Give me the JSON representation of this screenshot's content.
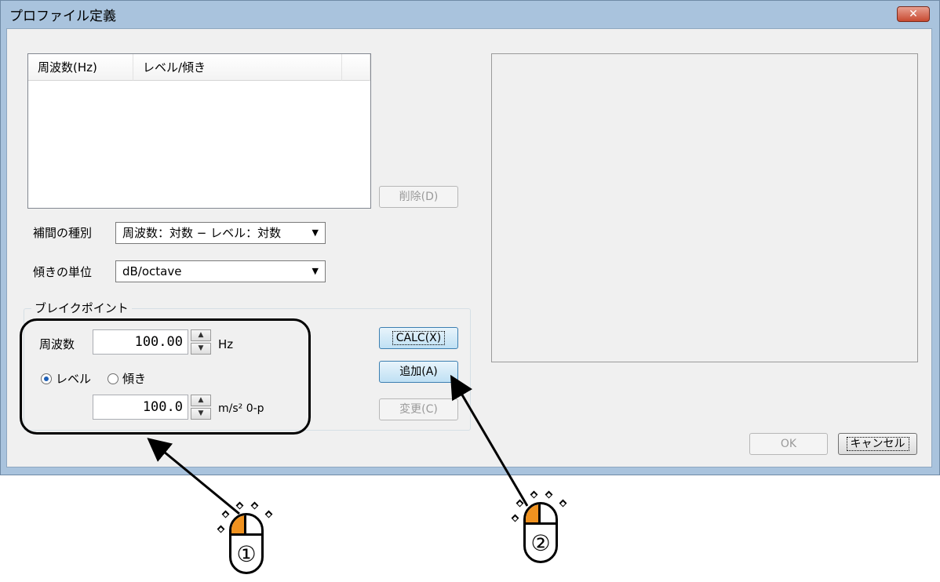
{
  "dialog": {
    "title": "プロファイル定義",
    "close_label": "✕"
  },
  "list": {
    "columns": [
      "周波数(Hz)",
      "レベル/傾き"
    ],
    "rows": []
  },
  "buttons": {
    "delete": "削除(D)",
    "calc": "CALC(X)",
    "add": "追加(A)",
    "change": "変更(C)",
    "ok": "OK",
    "cancel": "キャンセル"
  },
  "interpolation": {
    "label": "補間の種別",
    "value": "周波数：対数 − レベル：対数"
  },
  "slope_unit": {
    "label": "傾きの単位",
    "value": "dB/octave"
  },
  "breakpoint": {
    "legend": "ブレイクポイント",
    "freq_label": "周波数",
    "freq_value": "100.00",
    "freq_unit": "Hz",
    "radio_level": "レベル",
    "radio_slope": "傾き",
    "selected_mode": "level",
    "level_value": "100.0",
    "level_unit": "m/s² 0-p"
  },
  "annotations": {
    "callout_1": "①",
    "callout_2": "②"
  }
}
